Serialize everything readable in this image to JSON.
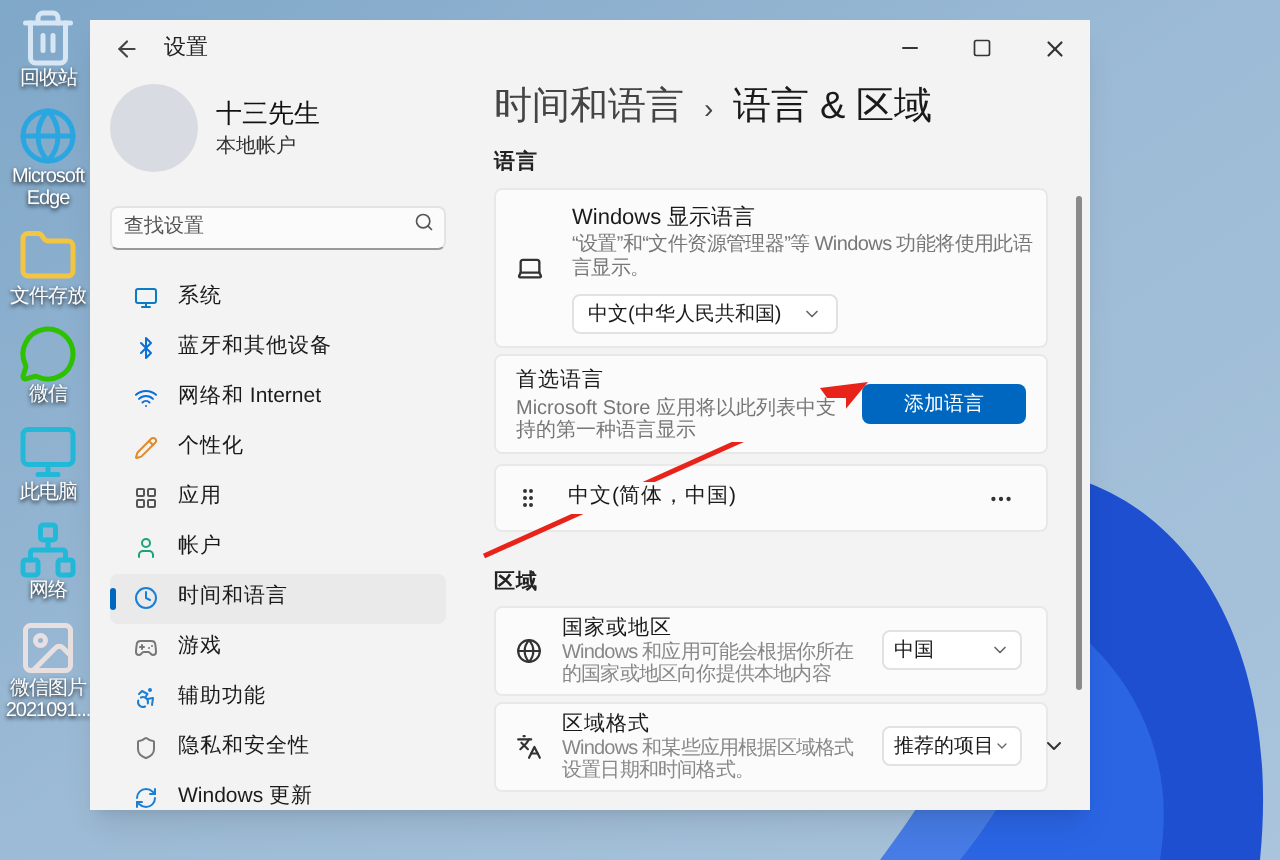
{
  "desktop_icons": [
    {
      "kind": "recycle",
      "label": "回收站"
    },
    {
      "kind": "edge",
      "label": "Microsoft Edge"
    },
    {
      "kind": "folder",
      "label": "文件存放"
    },
    {
      "kind": "chat",
      "label": "微信"
    },
    {
      "kind": "pc",
      "label": "此电脑"
    },
    {
      "kind": "network",
      "label": "网络"
    },
    {
      "kind": "image",
      "label": "微信图片 2021091..."
    }
  ],
  "window": {
    "title": "设置"
  },
  "profile": {
    "name": "十三先生",
    "account_type": "本地帐户"
  },
  "search": {
    "placeholder": "查找设置"
  },
  "nav_items": [
    {
      "kind": "system",
      "label": "系统",
      "selected": false
    },
    {
      "kind": "bluetooth",
      "label": "蓝牙和其他设备",
      "selected": false
    },
    {
      "kind": "wifi",
      "label": "网络和 Internet",
      "selected": false
    },
    {
      "kind": "pencil",
      "label": "个性化",
      "selected": false
    },
    {
      "kind": "apps",
      "label": "应用",
      "selected": false
    },
    {
      "kind": "user",
      "label": "帐户",
      "selected": false
    },
    {
      "kind": "time",
      "label": "时间和语言",
      "selected": true
    },
    {
      "kind": "game",
      "label": "游戏",
      "selected": false
    },
    {
      "kind": "access",
      "label": "辅助功能",
      "selected": false
    },
    {
      "kind": "shield",
      "label": "隐私和安全性",
      "selected": false
    },
    {
      "kind": "update",
      "label": "Windows 更新",
      "selected": false
    }
  ],
  "breadcrumb": {
    "parent": "时间和语言",
    "separator": "›",
    "current": "语言 & 区域"
  },
  "language_section": {
    "heading": "语言",
    "display_language": {
      "title": "Windows 显示语言",
      "description": "“设置”和“文件资源管理器”等 Windows 功能将使用此语言显示。",
      "value": "中文(中华人民共和国)"
    },
    "preferred": {
      "title": "首选语言",
      "description": "Microsoft Store 应用将以此列表中支持的第一种语言显示",
      "button": "添加语言"
    },
    "languages": [
      {
        "label": "中文(简体，中国)"
      }
    ]
  },
  "region_section": {
    "heading": "区域",
    "rows": [
      {
        "kind": "globe",
        "title": "国家或地区",
        "description": "Windows 和应用可能会根据你所在的国家或地区向你提供本地内容",
        "value": "中国",
        "expandable": false
      },
      {
        "kind": "format",
        "title": "区域格式",
        "description": "Windows 和某些应用根据区域格式设置日期和时间格式。",
        "value": "推荐的项目",
        "expandable": true
      }
    ]
  }
}
